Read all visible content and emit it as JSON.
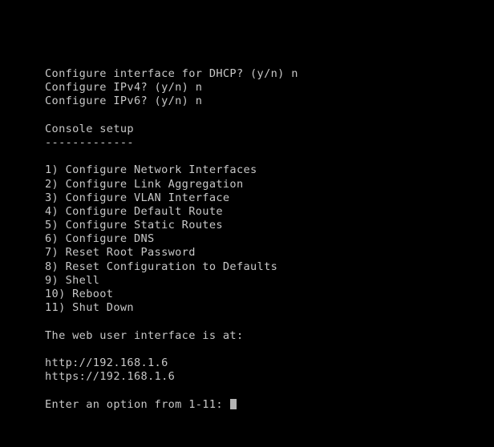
{
  "terminal": {
    "title": "Console setup",
    "background_color": "#000000",
    "text_color": "#c8c8c8",
    "cursor_color": "#b4b4b4",
    "prompts": {
      "dhcp": "Configure interface for DHCP? (y/n) n",
      "ipv4": "Configure IPv4? (y/n) n",
      "ipv6": "Configure IPv6? (y/n) n"
    },
    "header": {
      "title": "Console setup",
      "underline": "-------------"
    },
    "menu": [
      {
        "number": "1)",
        "label": "Configure Network Interfaces",
        "full": "1) Configure Network Interfaces"
      },
      {
        "number": "2)",
        "label": "Configure Link Aggregation",
        "full": "2) Configure Link Aggregation"
      },
      {
        "number": "3)",
        "label": "Configure VLAN Interface",
        "full": "3) Configure VLAN Interface"
      },
      {
        "number": "4)",
        "label": "Configure Default Route",
        "full": "4) Configure Default Route"
      },
      {
        "number": "5)",
        "label": "Configure Static Routes",
        "full": "5) Configure Static Routes"
      },
      {
        "number": "6)",
        "label": "Configure DNS",
        "full": "6) Configure DNS"
      },
      {
        "number": "7)",
        "label": "Reset Root Password",
        "full": "7) Reset Root Password"
      },
      {
        "number": "8)",
        "label": "Reset Configuration to Defaults",
        "full": "8) Reset Configuration to Defaults"
      },
      {
        "number": "9)",
        "label": "Shell",
        "full": "9) Shell"
      },
      {
        "number": "10)",
        "label": "Reboot",
        "full": "10) Reboot"
      },
      {
        "number": "11)",
        "label": "Shut Down",
        "full": "11) Shut Down"
      }
    ],
    "web_ui": {
      "heading": "The web user interface is at:",
      "urls": [
        "http://192.168.1.6",
        "https://192.168.1.6"
      ]
    },
    "input_prompt": {
      "text": "Enter an option from 1-11: ",
      "value": ""
    }
  }
}
